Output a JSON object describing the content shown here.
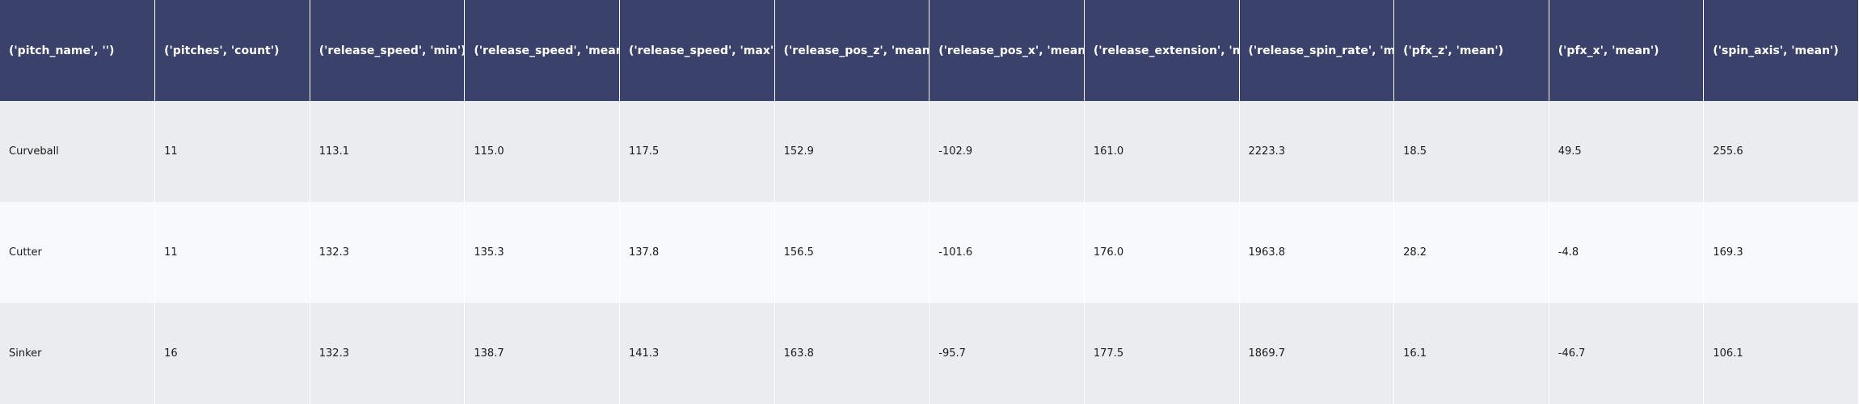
{
  "table": {
    "columns": [
      "('pitch_name', '')",
      "('pitches', 'count')",
      "('release_speed', 'min')",
      "('release_speed', 'mean')",
      "('release_speed', 'max')",
      "('release_pos_z', 'mean')",
      "('release_pos_x', 'mean')",
      "('release_extension', 'mean')",
      "('release_spin_rate', 'mean')",
      "('pfx_z', 'mean')",
      "('pfx_x', 'mean')",
      "('spin_axis', 'mean')"
    ],
    "rows": [
      [
        "Curveball",
        "11",
        "113.1",
        "115.0",
        "117.5",
        "152.9",
        "-102.9",
        "161.0",
        "2223.3",
        "18.5",
        "49.5",
        "255.6"
      ],
      [
        "Cutter",
        "11",
        "132.3",
        "135.3",
        "137.8",
        "156.5",
        "-101.6",
        "176.0",
        "1963.8",
        "28.2",
        "-4.8",
        "169.3"
      ],
      [
        "Sinker",
        "16",
        "132.3",
        "138.7",
        "141.3",
        "163.8",
        "-95.7",
        "177.5",
        "1869.7",
        "16.1",
        "-46.7",
        "106.1"
      ]
    ]
  },
  "colors": {
    "header_bg": "#3a426b",
    "header_text": "#ffffff",
    "row_odd_bg": "#ebecf0",
    "row_even_bg": "#f7f9fd",
    "cell_text": "#1a1a1a"
  }
}
